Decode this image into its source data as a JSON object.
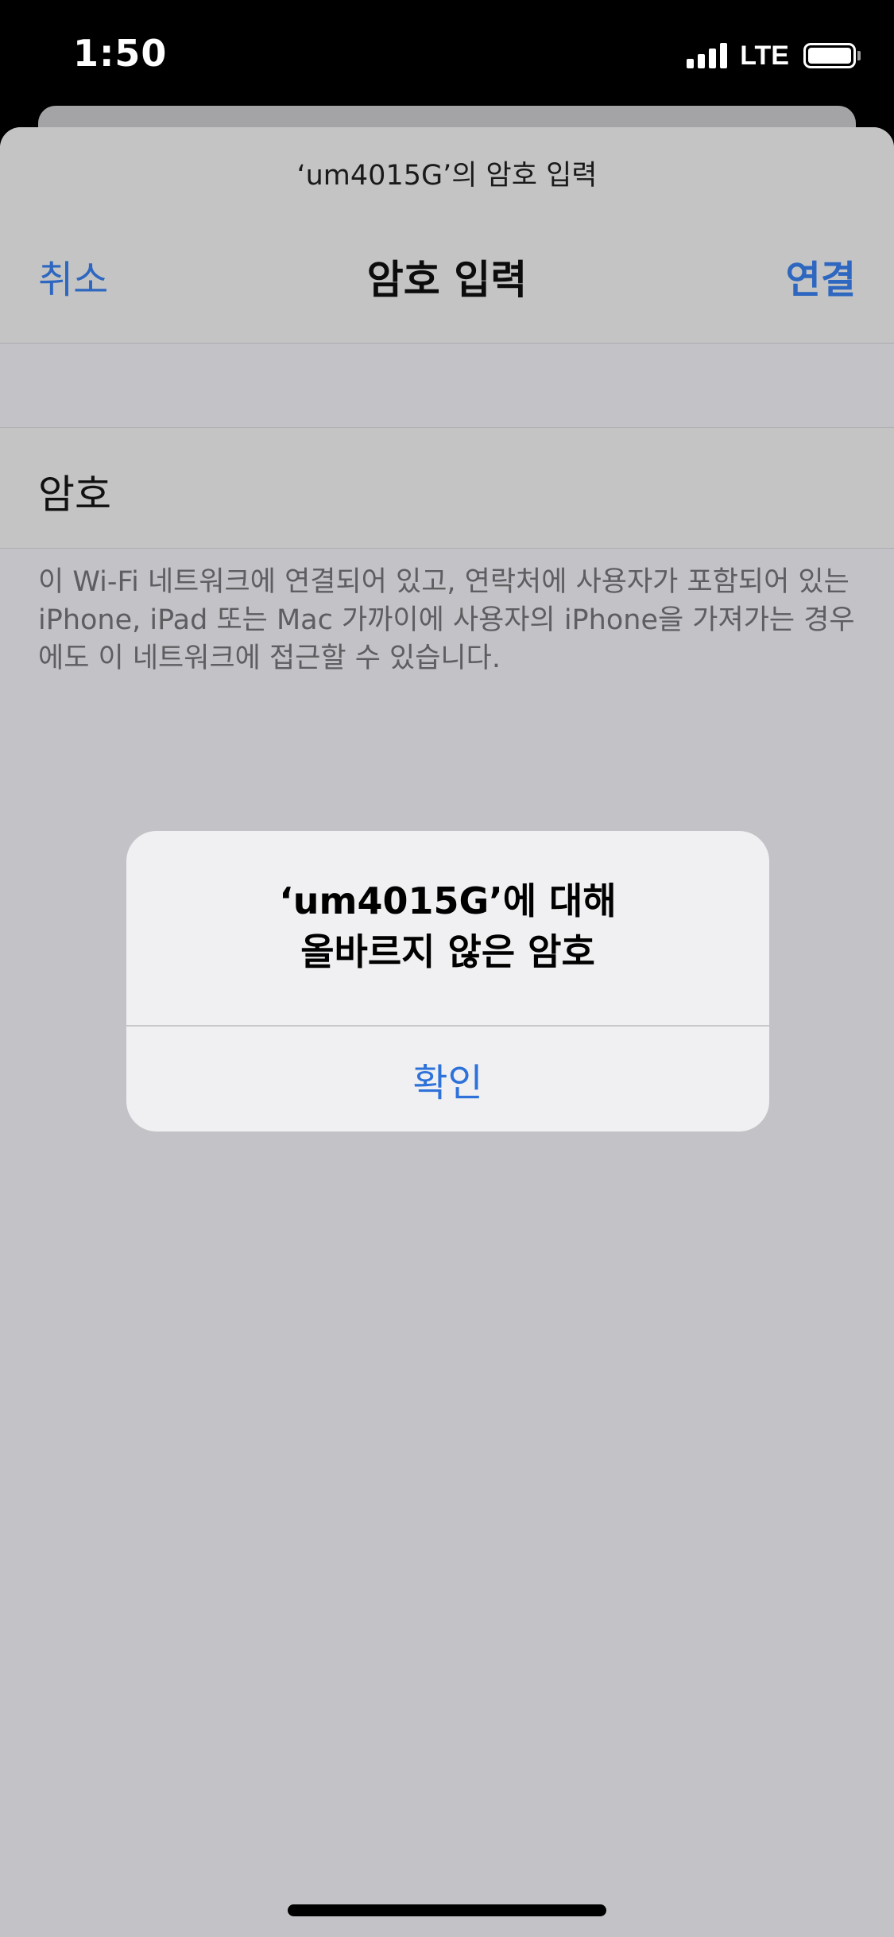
{
  "status_bar": {
    "time": "1:50",
    "network": "LTE",
    "signal_bars": 4,
    "battery_level": 1.0
  },
  "sheet": {
    "prompt": "‘um4015G’의 암호 입력",
    "nav": {
      "cancel_label": "취소",
      "title": "암호 입력",
      "connect_label": "연결"
    },
    "password_field": {
      "label": "암호",
      "value": ""
    },
    "footnote": "이 Wi-Fi 네트워크에 연결되어 있고, 연락처에 사용자가 포함되어 있는 iPhone, iPad 또는 Mac 가까이에 사용자의 iPhone을 가져가는 경우에도 이 네트워크에 접근할 수 있습니다."
  },
  "alert": {
    "title_line1": "‘um4015G’에 대해",
    "title_line2": "올바르지 않은 암호",
    "ok_label": "확인"
  },
  "colors": {
    "accent": "#2e67c0",
    "alert_button": "#2e72d9",
    "dim_background": "#c3c3c7",
    "alert_background": "#f0f0f2"
  },
  "icons": [
    "signal-icon",
    "battery-icon"
  ]
}
